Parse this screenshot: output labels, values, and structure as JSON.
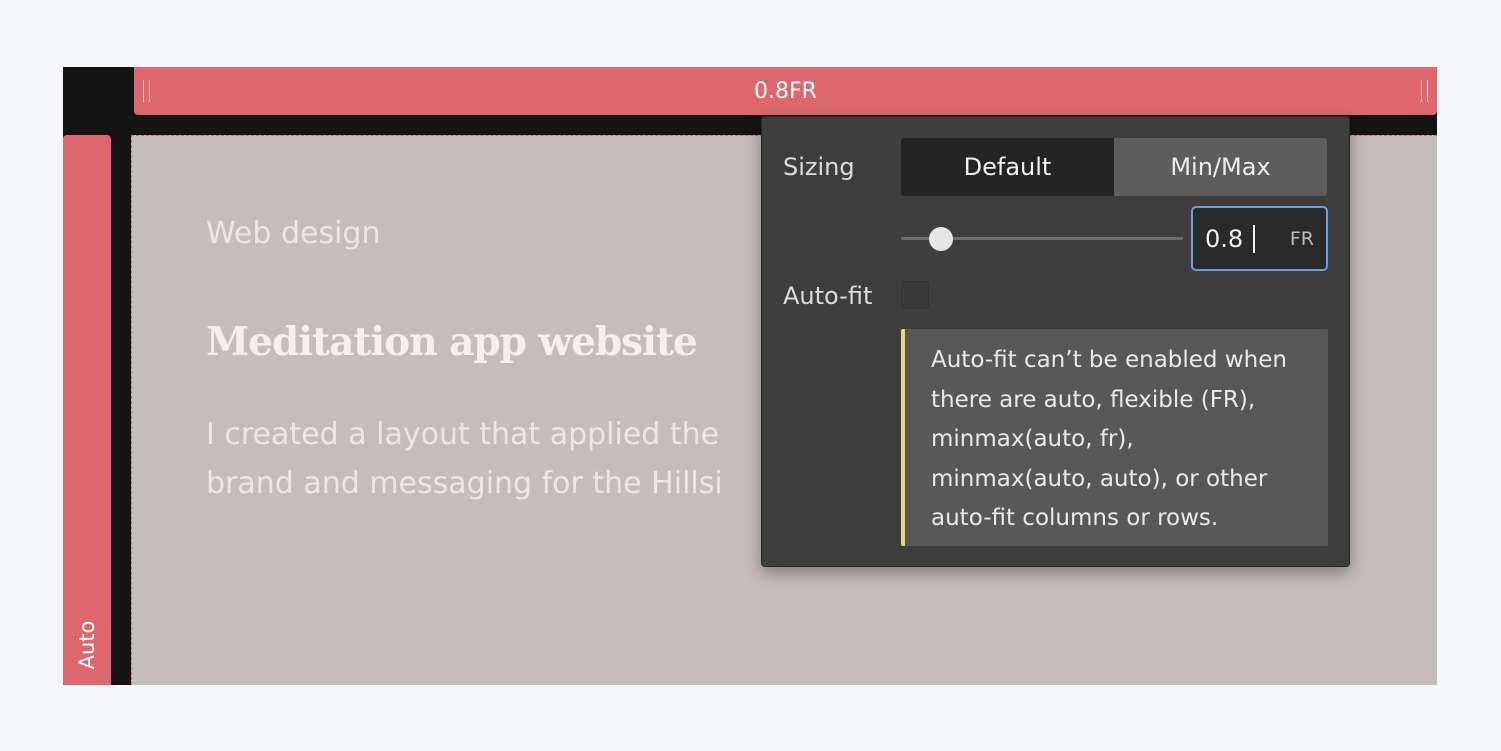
{
  "grid": {
    "column_size_label": "0.8FR",
    "row_size_label": "Auto"
  },
  "cell": {
    "eyebrow": "Web design",
    "heading": "Meditation app website",
    "body_lines": [
      "I created a layout that applied the",
      "brand and messaging for the Hillsi"
    ]
  },
  "popover": {
    "sizing_label": "Sizing",
    "tabs": [
      {
        "label": "Default",
        "selected": true
      },
      {
        "label": "Min/Max",
        "selected": false
      }
    ],
    "slider_value": 0.8,
    "fr_value": "0.8",
    "fr_unit": "FR",
    "autofit_label": "Auto-fit",
    "autofit_checked": false,
    "warning_text": "Auto-fit can’t be enabled when there are auto, flexible (FR), minmax(auto, fr), minmax(auto, auto), or other auto-fit columns or rows."
  },
  "colors": {
    "grid_accent": "#dd676c",
    "input_focus": "#6d9ce0",
    "warning_accent": "#ebd479"
  },
  "icons": {
    "column_grip_left": "drag-grip-icon",
    "column_grip_right": "drag-grip-icon"
  }
}
